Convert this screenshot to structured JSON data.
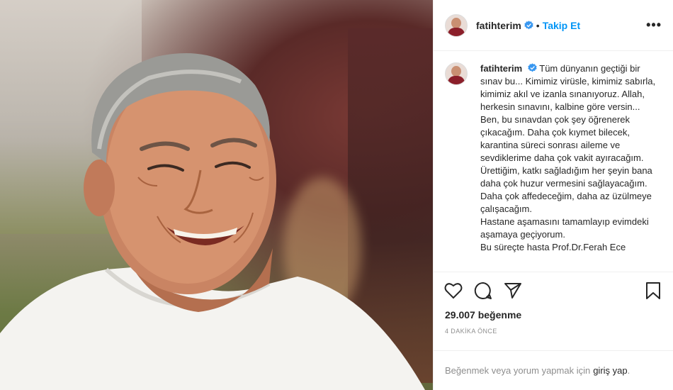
{
  "header": {
    "username": "fatihterim",
    "separator": "•",
    "follow_label": "Takip Et",
    "more_label": "•••",
    "verified_icon": "verified-badge-icon"
  },
  "caption": {
    "username": "fatihterim",
    "text": "Tüm dünyanın geçtiği bir sınav bu... Kimimiz virüsle, kimimiz sabırla, kimimiz akıl ve izanla sınanıyoruz. Allah, herkesin sınavını, kalbine göre versin... Ben, bu sınavdan çok şey öğrenerek çıkacağım. Daha çok kıymet bilecek, karantina süreci sonrası aileme ve sevdiklerime daha çok vakit ayıracağım.",
    "text2": "Ürettiğim, katkı sağladığım her şeyin bana daha çok huzur vermesini sağlayacağım. Daha çok affedeceğim, daha az üzülmeye çalışacağım.",
    "text3": "Hastane aşamasını tamamlayıp evimdeki aşamaya geçiyorum.",
    "text4": "Bu süreçte hasta Prof.Dr.Ferah Ece"
  },
  "actions": {
    "icons": [
      "heart-icon",
      "comment-icon",
      "share-icon",
      "bookmark-icon"
    ]
  },
  "likes": {
    "text": "29.007 beğenme"
  },
  "timestamp": "4 DAKİKA ÖNCE",
  "login": {
    "prompt": "Beğenmek veya yorum yapmak için",
    "link": "giriş yap",
    "suffix": "."
  },
  "colors": {
    "link_blue": "#0095f6",
    "text": "#262626",
    "muted": "#8e8e8e",
    "border": "#efefef"
  }
}
